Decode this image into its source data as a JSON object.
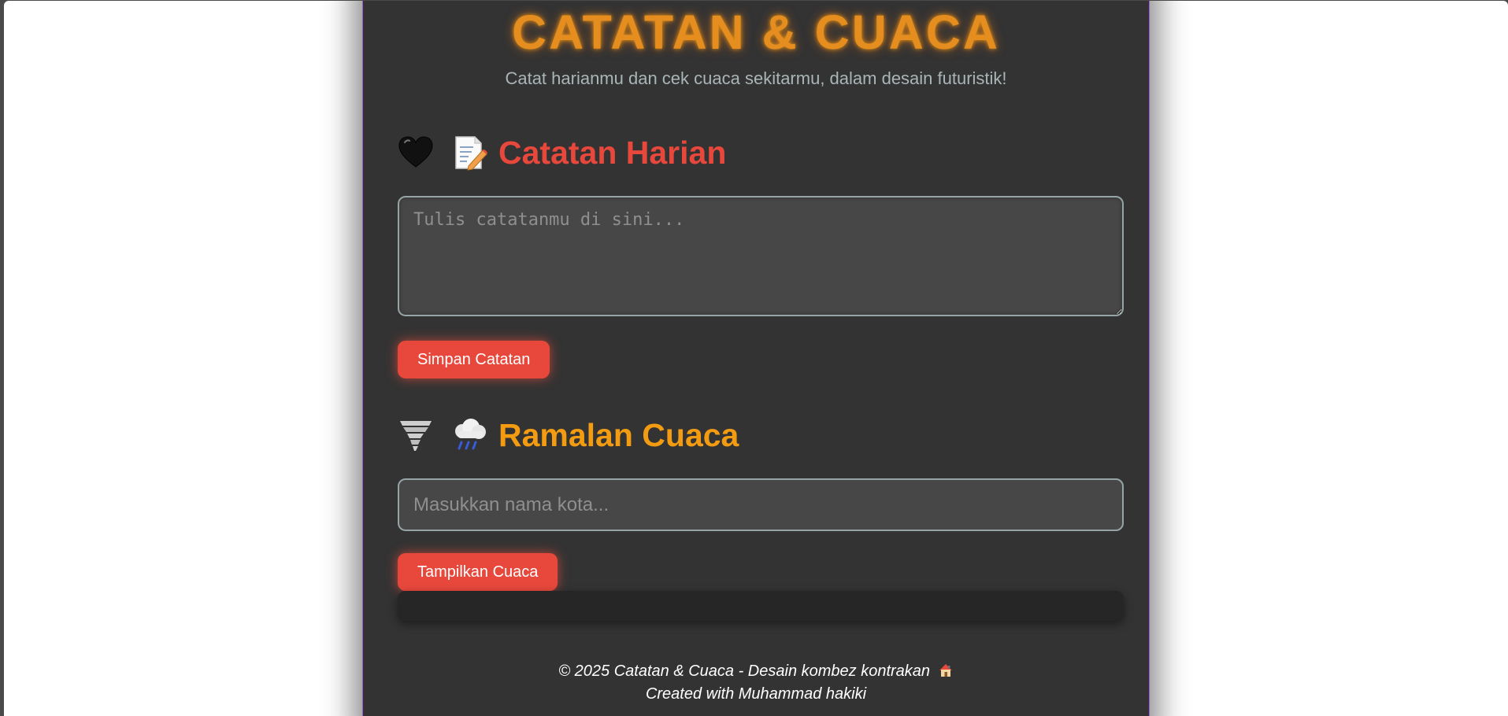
{
  "header": {
    "title": "CATATAN & CUACA",
    "subtitle": "Catat harianmu dan cek cuaca sekitarmu, dalam desain futuristik!"
  },
  "notes": {
    "heading": "Catatan Harian",
    "icons": [
      "black-heart-icon",
      "memo-icon"
    ],
    "textarea_placeholder": "Tulis catatanmu di sini...",
    "textarea_value": "",
    "save_label": "Simpan Catatan"
  },
  "weather": {
    "heading": "Ramalan Cuaca",
    "icons": [
      "tornado-icon",
      "cloud-rain-icon"
    ],
    "city_placeholder": "Masukkan nama kota...",
    "city_value": "",
    "show_label": "Tampilkan Cuaca",
    "result": ""
  },
  "footer": {
    "line1": "© 2025 Catatan & Cuaca - Desain kombez kontrakan",
    "line1_icon": "house-icon",
    "line2": "Created with Muhammad hakiki"
  },
  "colors": {
    "title": "#e58e1f",
    "notes_heading": "#e8483c",
    "weather_heading": "#f39c12",
    "button": "#e8483c",
    "panel": "#333333",
    "input_bg": "#474747"
  }
}
